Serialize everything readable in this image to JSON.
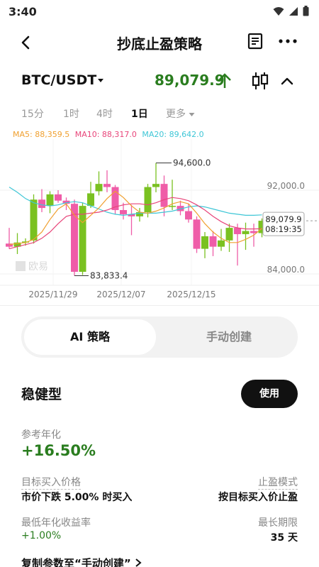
{
  "status_bar": {
    "time": "3:40"
  },
  "header": {
    "title": "抄底止盈策略"
  },
  "pair": {
    "name": "BTC/USDT",
    "price": "89,079.9"
  },
  "intervals": {
    "tabs": [
      "15分",
      "1时",
      "4时",
      "1日",
      "更多"
    ],
    "active": "1日"
  },
  "legend": {
    "ma5": "MA5: 88,359.5",
    "ma10": "MA10: 88,317.0",
    "ma20": "MA20: 89,642.0"
  },
  "colors": {
    "up": "#7ac121",
    "down": "#ef5da8",
    "ma5": "#f0a030",
    "ma10": "#e8457a",
    "ma20": "#3ec6d6",
    "price_green": "#2a7d1f"
  },
  "chart_data": {
    "type": "candlestick",
    "x_ticks": [
      "2025/11/29",
      "2025/12/07",
      "2025/12/15"
    ],
    "y_ticks": [
      92000.0,
      84000.0
    ],
    "annotations": {
      "high": "94,600.0",
      "low": "83,833.4"
    },
    "current_price": "89,079.9",
    "countdown": "08:19:35",
    "watermark": "欧易",
    "candles": [
      {
        "o": 86900,
        "h": 88400,
        "l": 86400,
        "c": 86600
      },
      {
        "o": 86600,
        "h": 87900,
        "l": 85900,
        "c": 87000
      },
      {
        "o": 87000,
        "h": 87400,
        "l": 86700,
        "c": 87100
      },
      {
        "o": 87200,
        "h": 91600,
        "l": 86900,
        "c": 91100
      },
      {
        "o": 91100,
        "h": 92100,
        "l": 89900,
        "c": 90300
      },
      {
        "o": 90500,
        "h": 91900,
        "l": 89800,
        "c": 91600
      },
      {
        "o": 91600,
        "h": 92000,
        "l": 90800,
        "c": 91000
      },
      {
        "o": 91000,
        "h": 91300,
        "l": 90100,
        "c": 90700
      },
      {
        "o": 90700,
        "h": 91100,
        "l": 83833.4,
        "c": 84200
      },
      {
        "o": 84200,
        "h": 90800,
        "l": 83900,
        "c": 90500
      },
      {
        "o": 90500,
        "h": 92800,
        "l": 90300,
        "c": 91700
      },
      {
        "o": 91900,
        "h": 93800,
        "l": 91500,
        "c": 92600
      },
      {
        "o": 92600,
        "h": 93900,
        "l": 91800,
        "c": 92300
      },
      {
        "o": 92300,
        "h": 92500,
        "l": 89700,
        "c": 90100
      },
      {
        "o": 90100,
        "h": 90800,
        "l": 89200,
        "c": 89700
      },
      {
        "o": 89700,
        "h": 90600,
        "l": 87700,
        "c": 89500
      },
      {
        "o": 89500,
        "h": 90300,
        "l": 89000,
        "c": 89900
      },
      {
        "o": 89900,
        "h": 92600,
        "l": 89400,
        "c": 92300
      },
      {
        "o": 92300,
        "h": 94600,
        "l": 91800,
        "c": 92600
      },
      {
        "o": 92600,
        "h": 93400,
        "l": 89500,
        "c": 90400
      },
      {
        "o": 90400,
        "h": 93000,
        "l": 90100,
        "c": 90500
      },
      {
        "o": 90500,
        "h": 91000,
        "l": 89600,
        "c": 90000
      },
      {
        "o": 90000,
        "h": 90700,
        "l": 88900,
        "c": 89200
      },
      {
        "o": 89200,
        "h": 89500,
        "l": 86000,
        "c": 86400
      },
      {
        "o": 86400,
        "h": 88000,
        "l": 85500,
        "c": 87600
      },
      {
        "o": 87600,
        "h": 88100,
        "l": 85700,
        "c": 86600
      },
      {
        "o": 86600,
        "h": 88300,
        "l": 86200,
        "c": 87200
      },
      {
        "o": 87200,
        "h": 88800,
        "l": 86100,
        "c": 88400
      },
      {
        "o": 88400,
        "h": 88800,
        "l": 84800,
        "c": 87800
      },
      {
        "o": 87800,
        "h": 88900,
        "l": 86300,
        "c": 88100
      },
      {
        "o": 88100,
        "h": 88800,
        "l": 86600,
        "c": 87900
      },
      {
        "o": 87900,
        "h": 89300,
        "l": 87500,
        "c": 89079.9
      }
    ],
    "ma5": [
      86800,
      86900,
      87000,
      87300,
      88000,
      89200,
      90200,
      90700,
      89600,
      88900,
      89600,
      90300,
      91200,
      91900,
      91300,
      90500,
      89900,
      89800,
      90000,
      90300,
      90700,
      90900,
      90700,
      89800,
      88800,
      88000,
      87400,
      87000,
      87000,
      87300,
      87700,
      88359.5
    ],
    "ma10": [
      86400,
      86600,
      86800,
      87000,
      87400,
      88000,
      88800,
      89500,
      89700,
      89700,
      89800,
      89900,
      90100,
      90400,
      90600,
      90700,
      90700,
      90600,
      90800,
      91100,
      91300,
      91200,
      91000,
      90600,
      90100,
      89500,
      89000,
      88600,
      88400,
      88300,
      88300,
      88317.0
    ],
    "ma20": [
      92300,
      91800,
      91200,
      90800,
      90600,
      90500,
      90600,
      90800,
      90900,
      90800,
      90500,
      90200,
      89900,
      89700,
      89600,
      89700,
      89800,
      89800,
      89800,
      89900,
      90000,
      90200,
      90400,
      90500,
      90400,
      90200,
      90000,
      89800,
      89700,
      89600,
      89600,
      89642.0
    ]
  },
  "segment": {
    "ai": "AI 策略",
    "manual": "手动创建"
  },
  "strategy": {
    "name": "稳健型",
    "use_label": "使用",
    "ref_label": "参考年化",
    "ref_value": "+16.50%",
    "target_label": "目标买入价格",
    "target_value": "市价下跌 5.00% 时买入",
    "tp_mode_label": "止盈模式",
    "tp_mode_value": "按目标买入价止盈",
    "min_yield_label": "最低年化收益率",
    "min_yield_value": "+1.00%",
    "max_period_label": "最长期限",
    "max_period_value": "35 天",
    "copy_link": "复制参数至“手动创建”"
  }
}
